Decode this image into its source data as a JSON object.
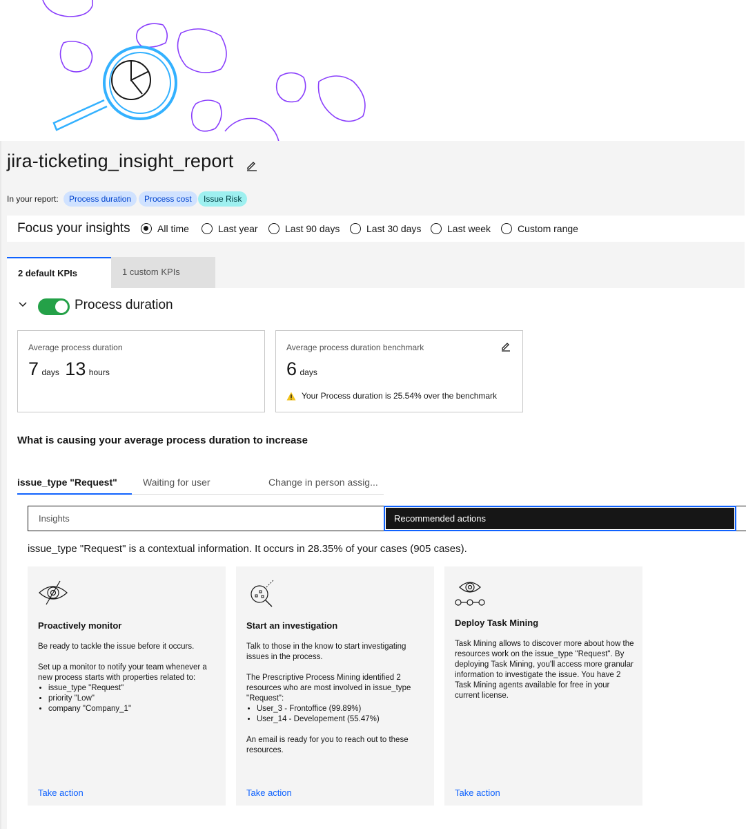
{
  "report": {
    "title": "jira-ticketing_insight_report",
    "in_your_report_label": "In your report:",
    "tags": [
      "Process duration",
      "Process cost",
      "Issue Risk"
    ]
  },
  "focus": {
    "label": "Focus your insights",
    "options": [
      "All time",
      "Last year",
      "Last 90 days",
      "Last 30 days",
      "Last week",
      "Custom range"
    ],
    "selected": "All time"
  },
  "kpi_tabs": [
    "2 default KPIs",
    "1 custom KPIs"
  ],
  "process_duration": {
    "title": "Process duration",
    "enabled": true,
    "average_card": {
      "label": "Average process duration",
      "days_value": "7",
      "days_unit": "days",
      "hours_value": "13",
      "hours_unit": "hours"
    },
    "benchmark_card": {
      "label": "Average process duration benchmark",
      "value": "6",
      "unit": "days",
      "warning": "Your Process duration is 25.54% over the benchmark"
    }
  },
  "causes": {
    "heading": "What is causing your average process duration to increase",
    "tabs": [
      "issue_type \"Request\"",
      "Waiting for user",
      "Change in person assig..."
    ],
    "switcher": [
      "Insights",
      "Recommended actions"
    ],
    "selected_switch": "Recommended actions",
    "context": "issue_type \"Request\" is a contextual information. It occurs in 28.35% of your cases (905 cases)."
  },
  "recommendations": [
    {
      "title": "Proactively monitor",
      "p1": "Be ready to tackle the issue before it occurs.",
      "p2": "Set up a monitor to notify your team whenever a new process starts with properties related to:",
      "bullets": [
        "issue_type \"Request\"",
        "priority \"Low\"",
        "company \"Company_1\""
      ],
      "link": "Take action",
      "icon": "eye-monitor-icon"
    },
    {
      "title": "Start an investigation",
      "p1": "Talk to those in the know to start investigating issues in the process.",
      "p2": "The Prescriptive Process Mining identified 2 resources who are most involved in issue_type \"Request\":",
      "bullets": [
        "User_3 - Frontoffice (99.89%)",
        "User_14 - Developement (55.47%)"
      ],
      "p3": "An email is ready for you to reach out to these resources.",
      "link": "Take action",
      "icon": "investigate-magnifier-icon"
    },
    {
      "title": "Deploy Task Mining",
      "p1": "Task Mining allows to discover more about how the resources work on the issue_type \"Request\". By deploying Task Mining, you'll access more granular information to investigate the issue. You have 2 Task Mining agents available for free in your current license.",
      "link": "Take action",
      "icon": "eye-flow-icon"
    }
  ],
  "colors": {
    "accent_blue": "#0f62fe",
    "toggle_green": "#24a148",
    "illustration_purple": "#8a3ffc",
    "illustration_blue": "#33b1ff",
    "warning_yellow": "#f1c21b"
  }
}
